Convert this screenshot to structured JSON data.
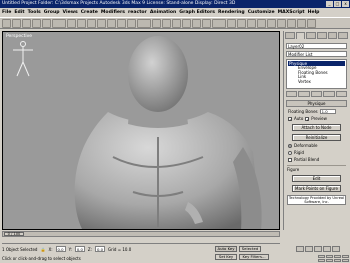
{
  "title": {
    "text": "Untitled     Project Folder: C:\\3dsmax Projects     Autodesk 3ds Max 9     License: Stand-alone     Display: Direct 3D",
    "min": "_",
    "max": "□",
    "close": "x"
  },
  "menu": [
    "File",
    "Edit",
    "Tools",
    "Group",
    "Views",
    "Create",
    "Modifiers",
    "reactor",
    "Animation",
    "Graph Editors",
    "Rendering",
    "Customize",
    "MAXScript",
    "Help"
  ],
  "viewport": {
    "label": "Perspective"
  },
  "panel": {
    "name": "Layer02",
    "modifier_list": "Modifier List",
    "stack_top": "Physique",
    "stack_items": [
      "Envelope",
      "Floating Bones",
      "Link",
      "Vertex"
    ],
    "rollout": "Physique",
    "floating_bones_label": "Floating Bones",
    "floating_value": "1.0",
    "auto_label": "Auto",
    "preview_label": "Preview",
    "attach_btn": "Attach to Node",
    "reinit_btn": "Reinitialize",
    "deformable_label": "Deformable",
    "rigid_label": "Rigid",
    "partial_label": "Partial Blend",
    "group_label": "Figure",
    "figure_btn": "Edit",
    "figure_points_btn": "Mark Points on Figure",
    "credit": "Technology Provided by Unreal Software, Inc."
  },
  "timeline": {
    "frame": "0 / 100"
  },
  "status": {
    "selected": "1 Object Selected",
    "x": "0.0",
    "y": "0.0",
    "z": "0.0",
    "grid": "Grid = 10.0",
    "autokey": "Auto Key",
    "setkey": "Set Key",
    "key_filters": "Key Filters...",
    "selected_mode": "Selected",
    "prompt": "Click or click-and-drag to select objects"
  },
  "colors": {
    "titlebar": "#0a246a",
    "viewport_bg": "#9a9a9a",
    "figure": "#b8b8b8"
  }
}
